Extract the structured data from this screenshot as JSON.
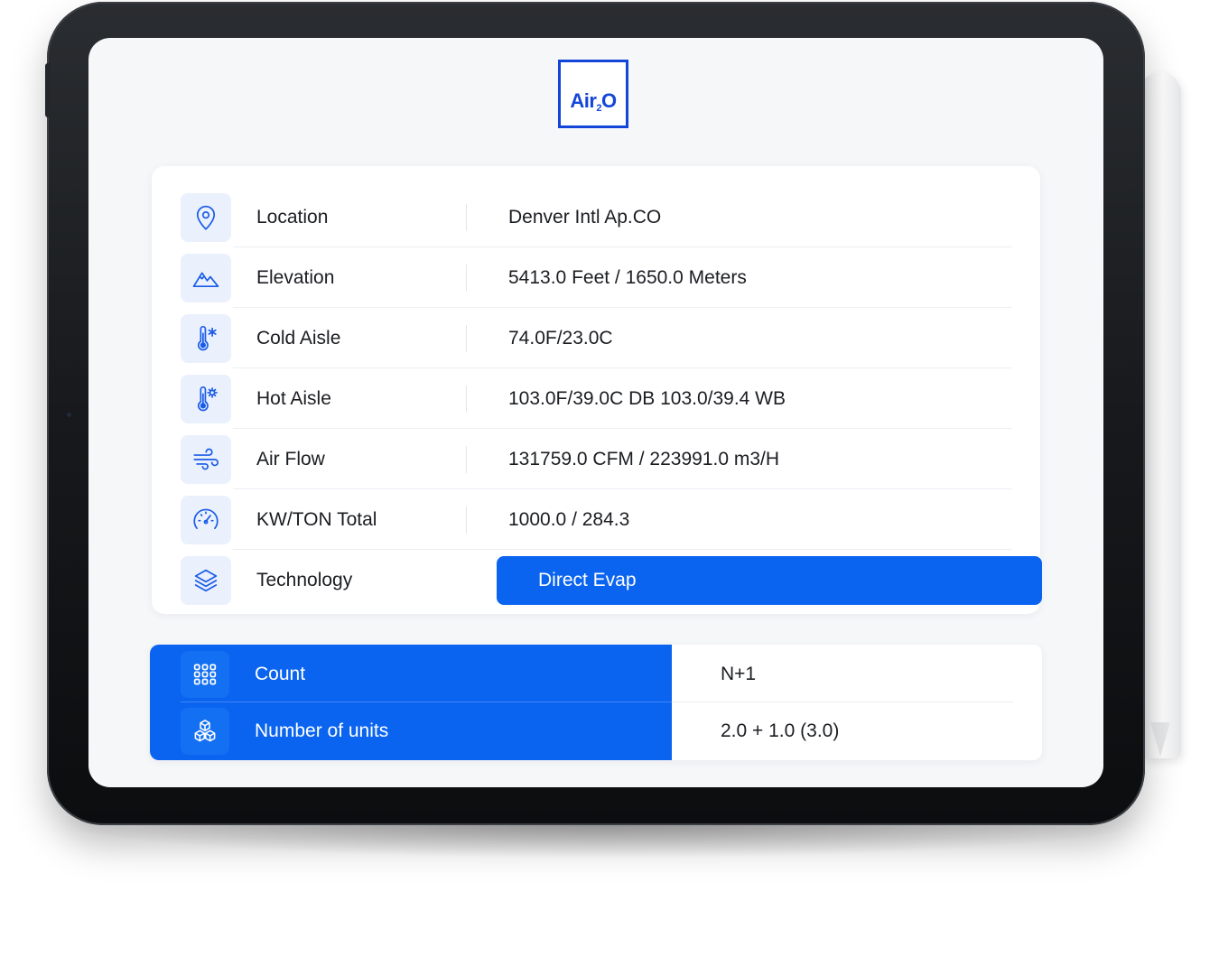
{
  "app": {
    "logo": "Air2O",
    "logo_main": "Air",
    "logo_sub": "2",
    "logo_end": "O"
  },
  "specs": [
    {
      "icon": "location-pin-icon",
      "label": "Location",
      "value": "Denver Intl Ap.CO"
    },
    {
      "icon": "mountain-icon",
      "label": "Elevation",
      "value": "5413.0 Feet / 1650.0 Meters"
    },
    {
      "icon": "thermometer-snowflake-icon",
      "label": "Cold Aisle",
      "value": "74.0F/23.0C"
    },
    {
      "icon": "thermometer-sun-icon",
      "label": "Hot Aisle",
      "value": "103.0F/39.0C DB 103.0/39.4 WB"
    },
    {
      "icon": "wind-icon",
      "label": "Air Flow",
      "value": "131759.0 CFM / 223991.0 m3/H"
    },
    {
      "icon": "gauge-icon",
      "label": "KW/TON Total",
      "value": "1000.0 / 284.3"
    },
    {
      "icon": "layers-icon",
      "label": "Technology",
      "value": "Direct Evap"
    }
  ],
  "units": [
    {
      "icon": "grid-dots-icon",
      "label": "Count",
      "value": "N+1"
    },
    {
      "icon": "boxes-icon",
      "label": "Number of units",
      "value": "2.0 + 1.0 (3.0)"
    }
  ],
  "colors": {
    "accent": "#0a64f0",
    "logo": "#1346d8",
    "icon_bg": "#eaf1fd",
    "text": "#1b1d22"
  }
}
